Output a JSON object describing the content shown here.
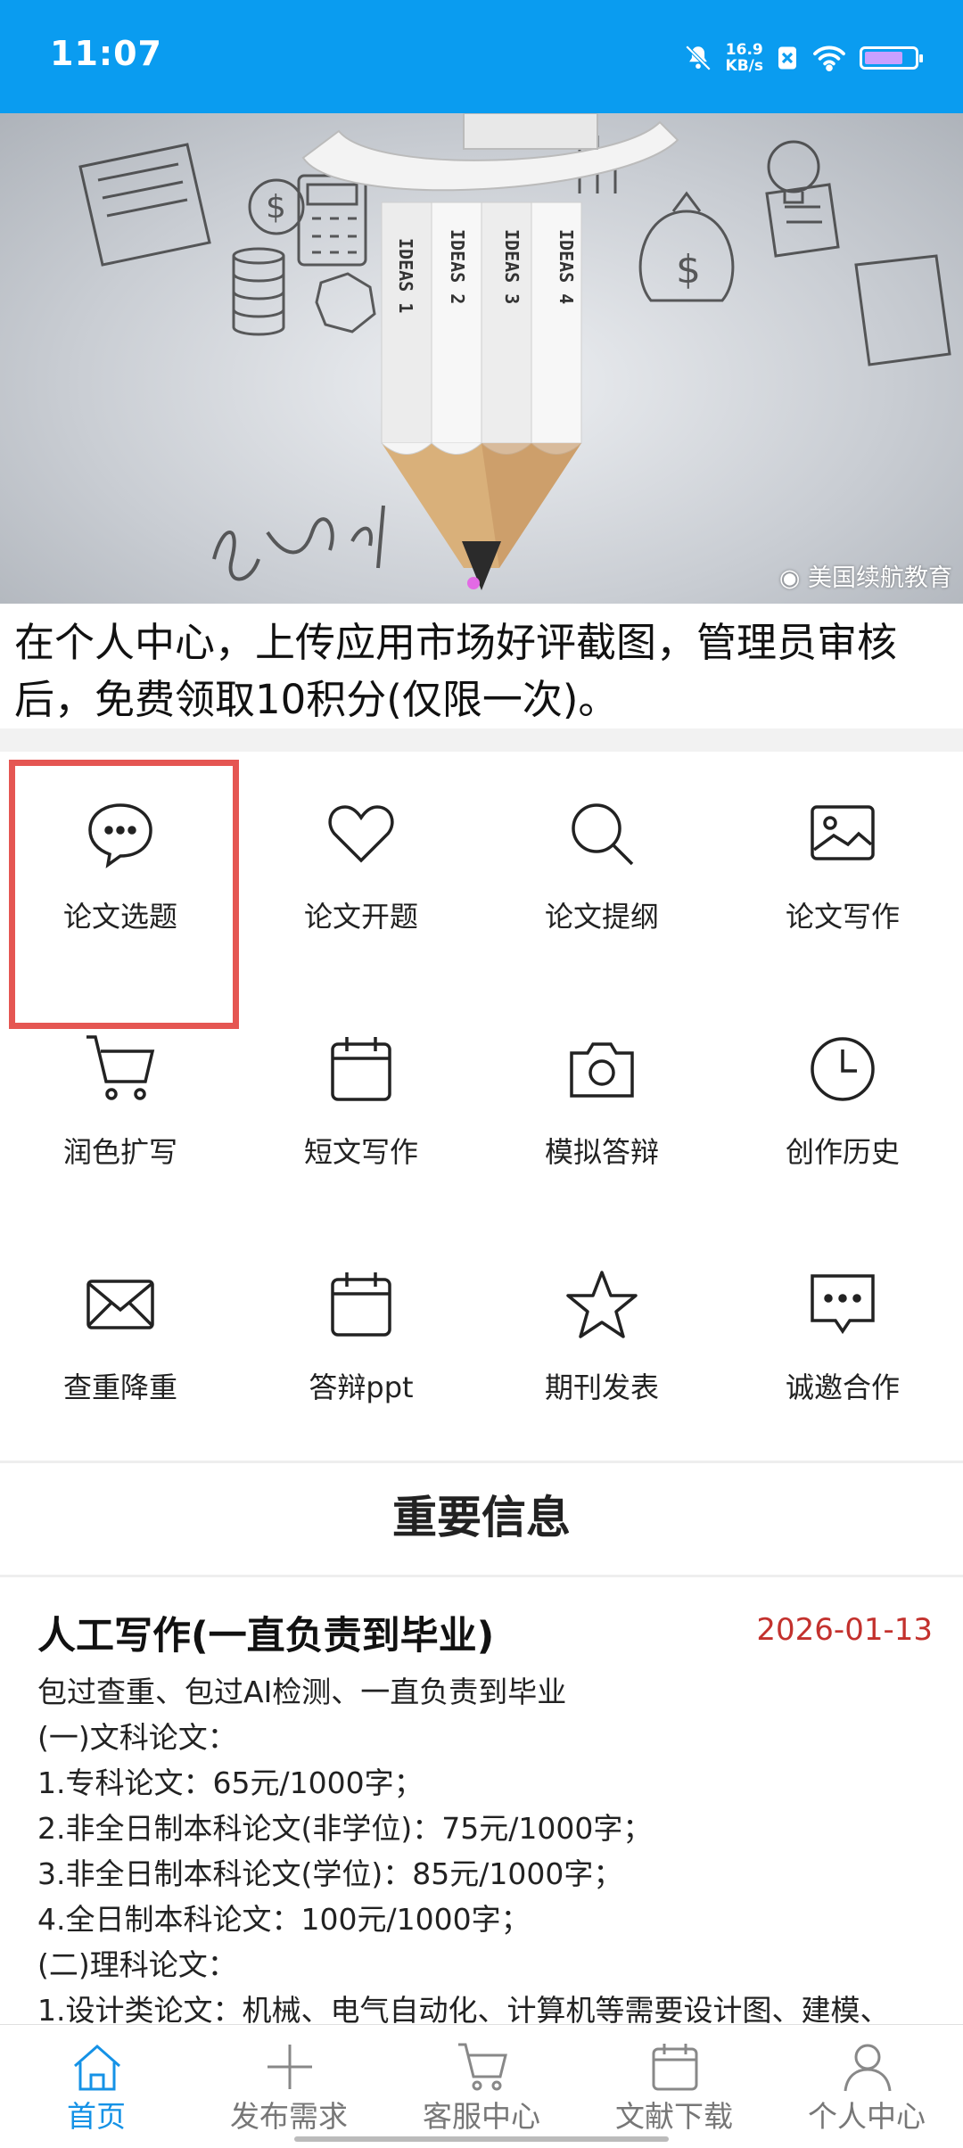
{
  "status_bar": {
    "time": "11:07",
    "speed_value": "16.9",
    "speed_unit": "KB/s",
    "bg_color": "#0a9cf0"
  },
  "banner": {
    "pencil_ideas": [
      "IDEAS 1",
      "IDEAS 2",
      "IDEAS 3",
      "IDEAS 4"
    ],
    "watermark": "美国续航教育"
  },
  "notice": {
    "text": "在个人中心，上传应用市场好评截图，管理员审核后，免费领取10积分(仅限一次)。"
  },
  "grid": {
    "items": [
      {
        "label": "论文选题",
        "icon": "chat-bubble-icon"
      },
      {
        "label": "论文开题",
        "icon": "heart-icon"
      },
      {
        "label": "论文提纲",
        "icon": "search-icon"
      },
      {
        "label": "论文写作",
        "icon": "image-icon"
      },
      {
        "label": "润色扩写",
        "icon": "cart-icon"
      },
      {
        "label": "短文写作",
        "icon": "calendar-icon"
      },
      {
        "label": "模拟答辩",
        "icon": "camera-icon"
      },
      {
        "label": "创作历史",
        "icon": "clock-icon"
      },
      {
        "label": "查重降重",
        "icon": "envelope-icon"
      },
      {
        "label": "答辩ppt",
        "icon": "calendar-icon"
      },
      {
        "label": "期刊发表",
        "icon": "star-icon"
      },
      {
        "label": "诚邀合作",
        "icon": "message-icon"
      }
    ],
    "selected_index": 0
  },
  "section": {
    "title": "重要信息"
  },
  "article": {
    "title": "人工写作(一直负责到毕业)",
    "date": "2026-01-13",
    "lines": [
      "包过查重、包过AI检测、一直负责到毕业",
      "(一)文科论文：",
      "1.专科论文：65元/1000字；",
      "2.非全日制本科论文(非学位)：75元/1000字；",
      "3.非全日制本科论文(学位)：85元/1000字；",
      "4.全日制本科论文：100元/1000字；",
      "(二)理科论文：",
      "1.设计类论文：机械、电气自动化、计算机等需要设计图、建模、"
    ]
  },
  "bottom_nav": {
    "items": [
      {
        "label": "首页",
        "icon": "home-icon",
        "active": true
      },
      {
        "label": "发布需求",
        "icon": "plus-icon",
        "active": false
      },
      {
        "label": "客服中心",
        "icon": "cart-icon",
        "active": false
      },
      {
        "label": "文献下载",
        "icon": "calendar-icon",
        "active": false
      },
      {
        "label": "个人中心",
        "icon": "person-icon",
        "active": false
      }
    ],
    "active_color": "#1592e6"
  }
}
